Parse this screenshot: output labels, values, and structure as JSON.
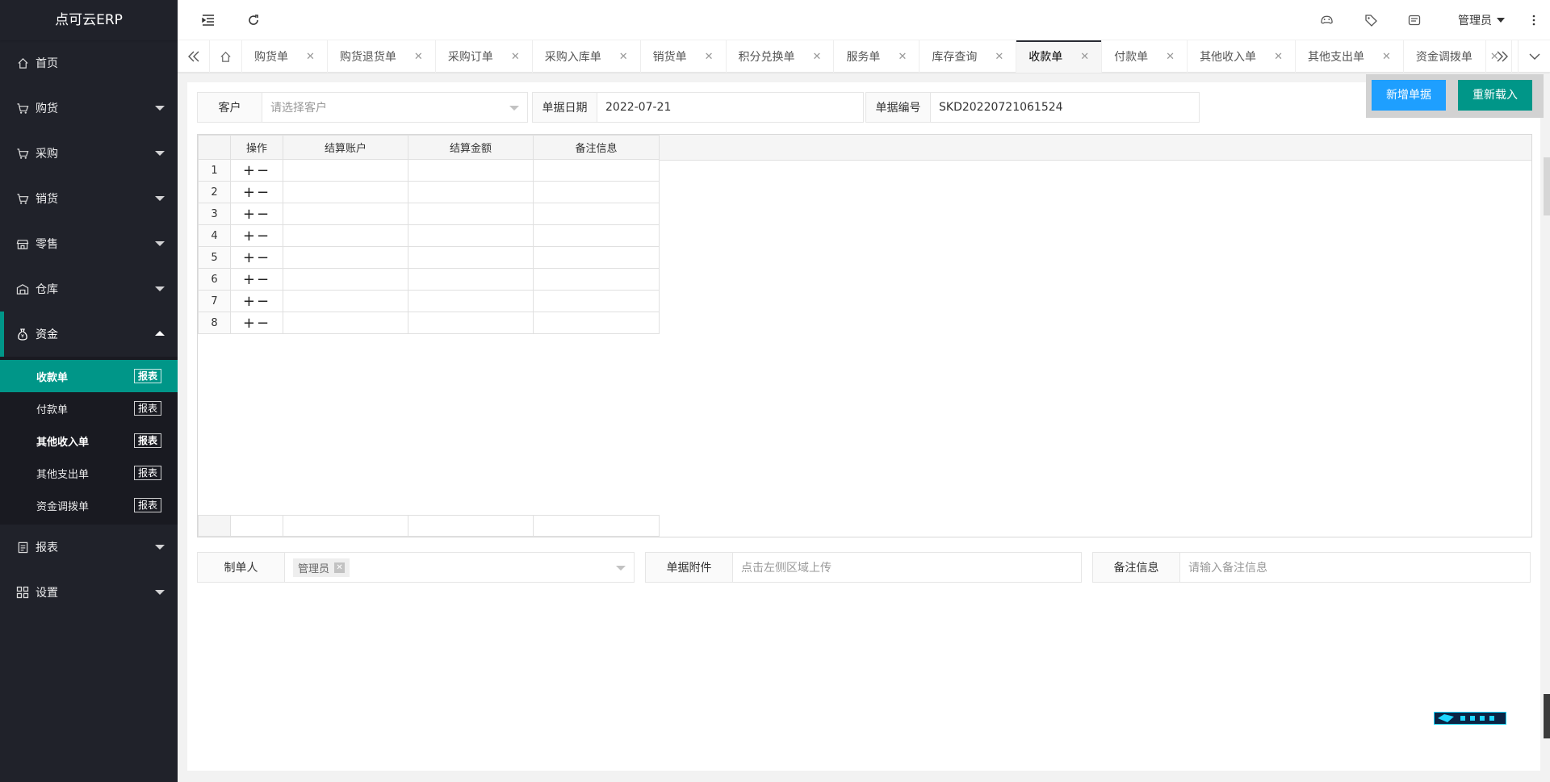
{
  "app": {
    "title": "点可云ERP"
  },
  "sidebar": {
    "items": [
      {
        "label": "首页",
        "icon": "home-icon"
      },
      {
        "label": "购货",
        "icon": "cart-icon"
      },
      {
        "label": "采购",
        "icon": "cart-icon"
      },
      {
        "label": "销货",
        "icon": "cart-icon"
      },
      {
        "label": "零售",
        "icon": "store-icon"
      },
      {
        "label": "仓库",
        "icon": "warehouse-icon"
      },
      {
        "label": "资金",
        "icon": "money-bag-icon"
      },
      {
        "label": "报表",
        "icon": "report-icon"
      },
      {
        "label": "设置",
        "icon": "grid-icon"
      }
    ],
    "sub_items": [
      {
        "label": "收款单",
        "badge": "报表"
      },
      {
        "label": "付款单",
        "badge": "报表"
      },
      {
        "label": "其他收入单",
        "badge": "报表"
      },
      {
        "label": "其他支出单",
        "badge": "报表"
      },
      {
        "label": "资金调拨单",
        "badge": "报表"
      }
    ]
  },
  "header": {
    "user": "管理员"
  },
  "tabs": [
    {
      "label": "购货单"
    },
    {
      "label": "购货退货单"
    },
    {
      "label": "采购订单"
    },
    {
      "label": "采购入库单"
    },
    {
      "label": "销货单"
    },
    {
      "label": "积分兑换单"
    },
    {
      "label": "服务单"
    },
    {
      "label": "库存查询"
    },
    {
      "label": "收款单"
    },
    {
      "label": "付款单"
    },
    {
      "label": "其他收入单"
    },
    {
      "label": "其他支出单"
    },
    {
      "label": "资金调拨单"
    }
  ],
  "form": {
    "customer_label": "客户",
    "customer_placeholder": "请选择客户",
    "date_label": "单据日期",
    "date_value": "2022-07-21",
    "number_label": "单据编号",
    "number_value": "SKD20220721061524"
  },
  "buttons": {
    "new": "新增单据",
    "reload": "重新载入"
  },
  "grid": {
    "columns": [
      "操作",
      "结算账户",
      "结算金额",
      "备注信息"
    ],
    "rows": [
      "1",
      "2",
      "3",
      "4",
      "5",
      "6",
      "7",
      "8"
    ],
    "op_symbol": "+−"
  },
  "bottom": {
    "maker_label": "制单人",
    "maker_tag": "管理员",
    "attach_label": "单据附件",
    "attach_placeholder": "点击左侧区域上传",
    "note_label": "备注信息",
    "note_placeholder": "请输入备注信息"
  },
  "colors": {
    "accent": "#009688",
    "blue": "#1e9fff",
    "sidebar": "#20222a"
  }
}
